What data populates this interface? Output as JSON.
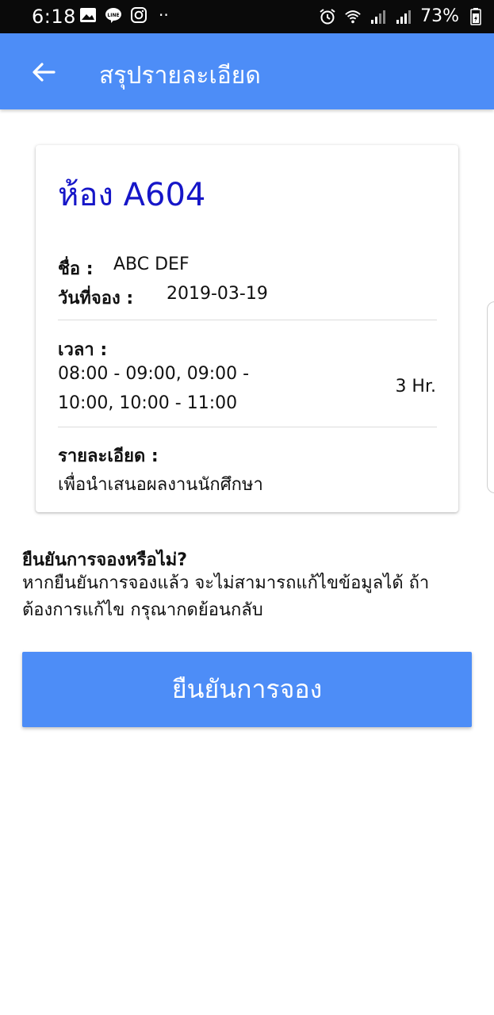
{
  "status_bar": {
    "time": "6:18",
    "battery": "73%",
    "icons": [
      "image-icon",
      "line-icon",
      "instagram-icon",
      "more-dots",
      "alarm-icon",
      "wifi-icon",
      "signal-icon",
      "signal-icon",
      "battery-icon"
    ],
    "more": "··"
  },
  "app_bar": {
    "title": "สรุปรายละเอียด",
    "color": "#4d8df7"
  },
  "booking": {
    "room": "ห้อง A604",
    "name_label": "ชื่อ :",
    "name_value": "ABC DEF",
    "date_label": "วันที่จอง :",
    "date_value": "2019-03-19",
    "time_label": "เวลา :",
    "time_value": "08:00 - 09:00, 09:00 - 10:00, 10:00 - 11:00",
    "duration": "3 Hr.",
    "detail_label": "รายละเอียด :",
    "detail_value": "เพื่อนำเสนอผลงานนักศึกษา",
    "room_color": "#1616c8"
  },
  "confirm": {
    "question": "ยืนยันการจองหรือไม่?",
    "message": "หากยืนยันการจองแล้ว จะไม่สามารถแก้ไขข้อมูลได้ ถ้าต้องการแก้ไข กรุณากดย้อนกลับ",
    "button_label": "ยืนยันการจอง"
  }
}
